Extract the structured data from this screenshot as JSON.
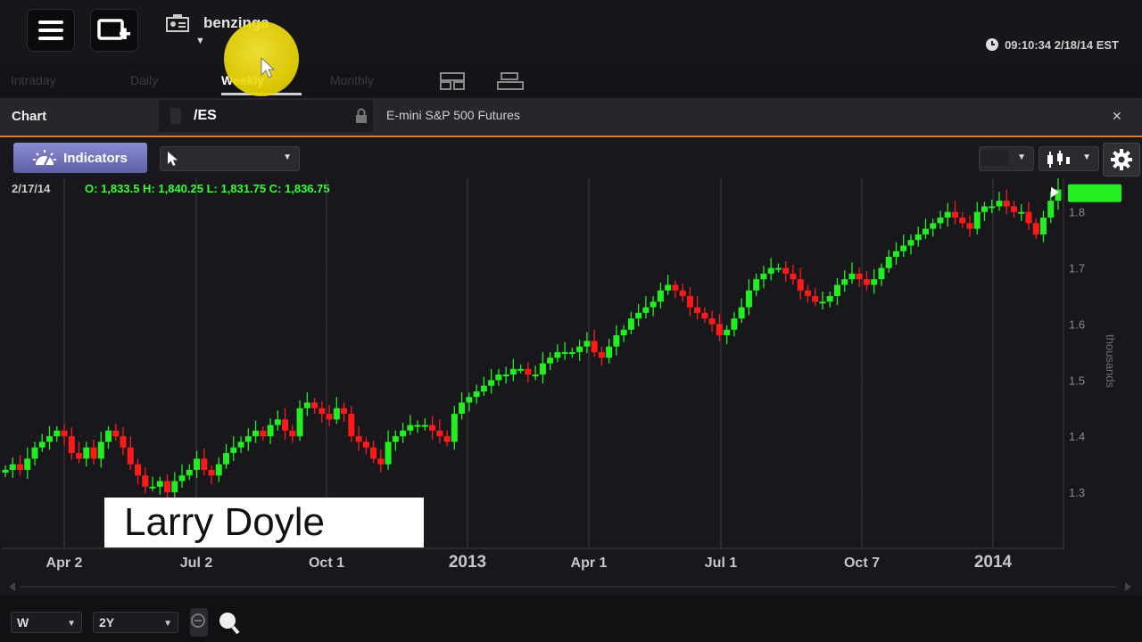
{
  "app": {
    "brand": "benzinga",
    "clock": "09:10:34 2/18/14 EST"
  },
  "tabs": [
    {
      "label": "Intraday",
      "active": false
    },
    {
      "label": "Daily",
      "active": false
    },
    {
      "label": "Weekly",
      "active": true
    },
    {
      "label": "Monthly",
      "active": false
    }
  ],
  "header": {
    "section_label": "Chart",
    "symbol": "/ES",
    "description": "E-mini S&P 500 Futures"
  },
  "toolbar": {
    "indicators_label": "Indicators"
  },
  "info": {
    "date": "2/17/14",
    "ohlc": "O: 1,833.5 H: 1,840.25 L: 1,831.75 C: 1,836.75"
  },
  "overlay": {
    "caption": "Larry Doyle"
  },
  "bottom": {
    "interval": "W",
    "range": "2Y"
  },
  "colors": {
    "up": "#22ee22",
    "down": "#ff1a1a",
    "accent": "#e3781e",
    "indicators_button": "#7777c4"
  },
  "chart_data": {
    "type": "candlestick",
    "x_labels": [
      "Apr 2",
      "Jul 2",
      "Oct 1",
      "2013",
      "Apr 1",
      "Jul 1",
      "Oct 7",
      "2014"
    ],
    "y_ticks": [
      1.3,
      1.4,
      1.5,
      1.6,
      1.7,
      1.8
    ],
    "ylabel": "thousands",
    "ylim": [
      1.2,
      1.86
    ],
    "grid": true,
    "weekly_close": [
      1.34,
      1.35,
      1.34,
      1.36,
      1.38,
      1.39,
      1.4,
      1.41,
      1.4,
      1.37,
      1.36,
      1.38,
      1.36,
      1.39,
      1.41,
      1.4,
      1.38,
      1.35,
      1.33,
      1.31,
      1.31,
      1.32,
      1.3,
      1.32,
      1.33,
      1.34,
      1.36,
      1.34,
      1.33,
      1.35,
      1.37,
      1.38,
      1.39,
      1.4,
      1.41,
      1.4,
      1.42,
      1.43,
      1.41,
      1.4,
      1.45,
      1.46,
      1.45,
      1.44,
      1.43,
      1.45,
      1.44,
      1.4,
      1.39,
      1.38,
      1.36,
      1.35,
      1.39,
      1.4,
      1.41,
      1.42,
      1.42,
      1.42,
      1.41,
      1.4,
      1.39,
      1.44,
      1.46,
      1.47,
      1.48,
      1.49,
      1.5,
      1.51,
      1.51,
      1.52,
      1.52,
      1.51,
      1.51,
      1.53,
      1.54,
      1.55,
      1.55,
      1.55,
      1.56,
      1.57,
      1.55,
      1.54,
      1.56,
      1.58,
      1.59,
      1.61,
      1.62,
      1.63,
      1.64,
      1.66,
      1.67,
      1.66,
      1.65,
      1.63,
      1.62,
      1.61,
      1.6,
      1.58,
      1.59,
      1.61,
      1.63,
      1.66,
      1.68,
      1.69,
      1.7,
      1.7,
      1.69,
      1.68,
      1.66,
      1.65,
      1.64,
      1.64,
      1.65,
      1.67,
      1.68,
      1.69,
      1.68,
      1.67,
      1.68,
      1.7,
      1.72,
      1.73,
      1.74,
      1.75,
      1.76,
      1.77,
      1.78,
      1.79,
      1.8,
      1.79,
      1.78,
      1.77,
      1.8,
      1.81,
      1.81,
      1.82,
      1.81,
      1.8,
      1.8,
      1.78,
      1.76,
      1.79,
      1.82,
      1.84
    ],
    "last_close": 1836.75
  }
}
